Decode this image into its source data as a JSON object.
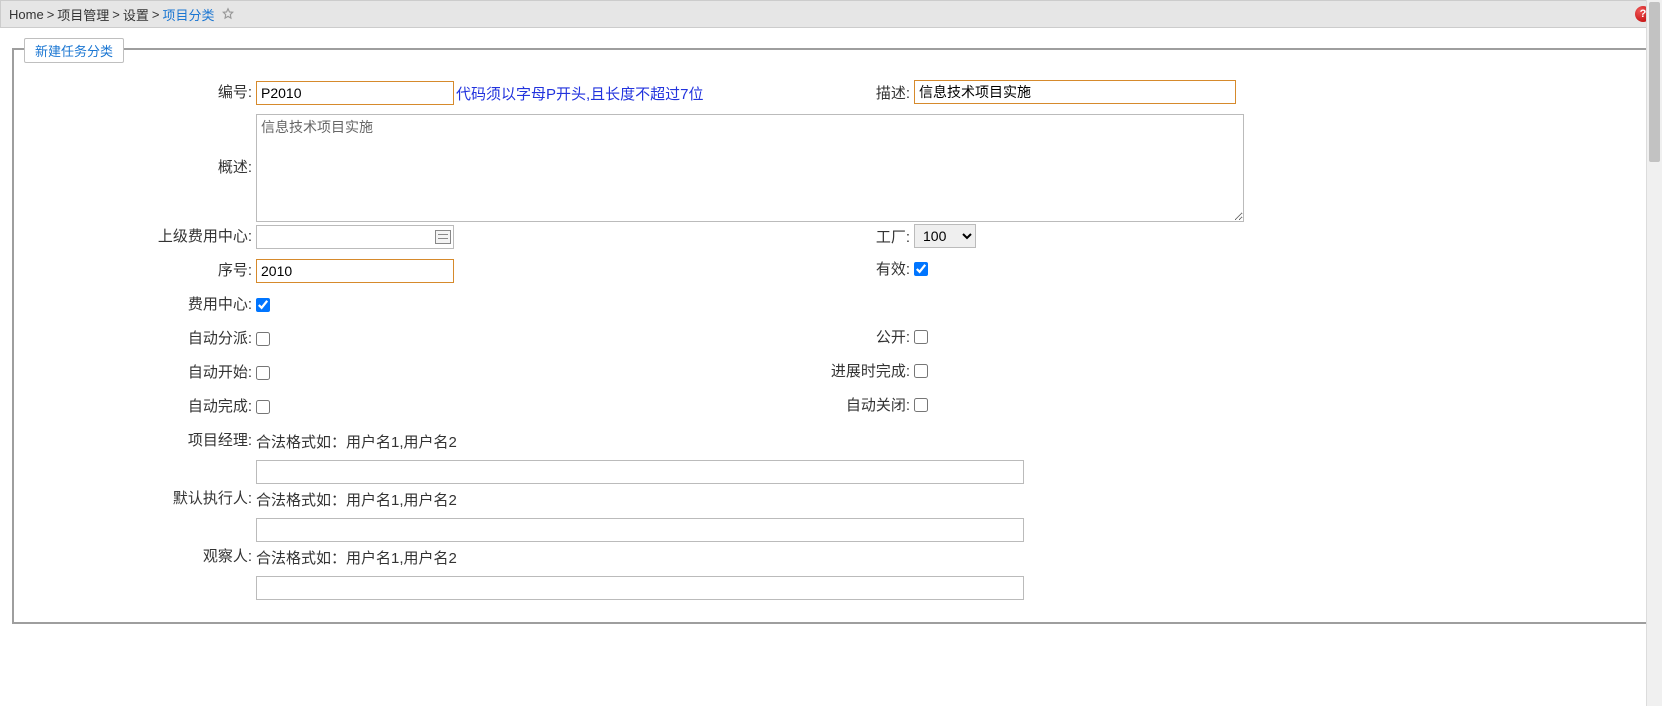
{
  "breadcrumb": {
    "items": [
      "Home",
      "项目管理",
      "设置",
      "项目分类"
    ],
    "sep": ">"
  },
  "legend": "新建任务分类",
  "labels": {
    "code": "编号:",
    "desc": "描述:",
    "overview": "概述:",
    "parentCost": "上级费用中心:",
    "plant": "工厂:",
    "seq": "序号:",
    "active": "有效:",
    "costCenter": "费用中心:",
    "autoAssign": "自动分派:",
    "public": "公开:",
    "autoStart": "自动开始:",
    "progressDone": "进展时完成:",
    "autoComplete": "自动完成:",
    "autoClose": "自动关闭:",
    "pm": "项目经理:",
    "defExec": "默认执行人:",
    "observer": "观察人:"
  },
  "hints": {
    "codeRule": "代码须以字母P开头,且长度不超过7位",
    "userFormat": "合法格式如：用户名1,用户名2"
  },
  "values": {
    "code": "P2010",
    "desc": "信息技术项目实施",
    "overview": "信息技术项目实施",
    "parentCost": "",
    "plant": "100",
    "seq": "2010",
    "active": true,
    "costCenter": true,
    "autoAssign": false,
    "public": false,
    "autoStart": false,
    "progressDone": false,
    "autoComplete": false,
    "autoClose": false,
    "pm": "",
    "defExec": "",
    "observer": ""
  },
  "options": {
    "plant": [
      "100"
    ]
  }
}
